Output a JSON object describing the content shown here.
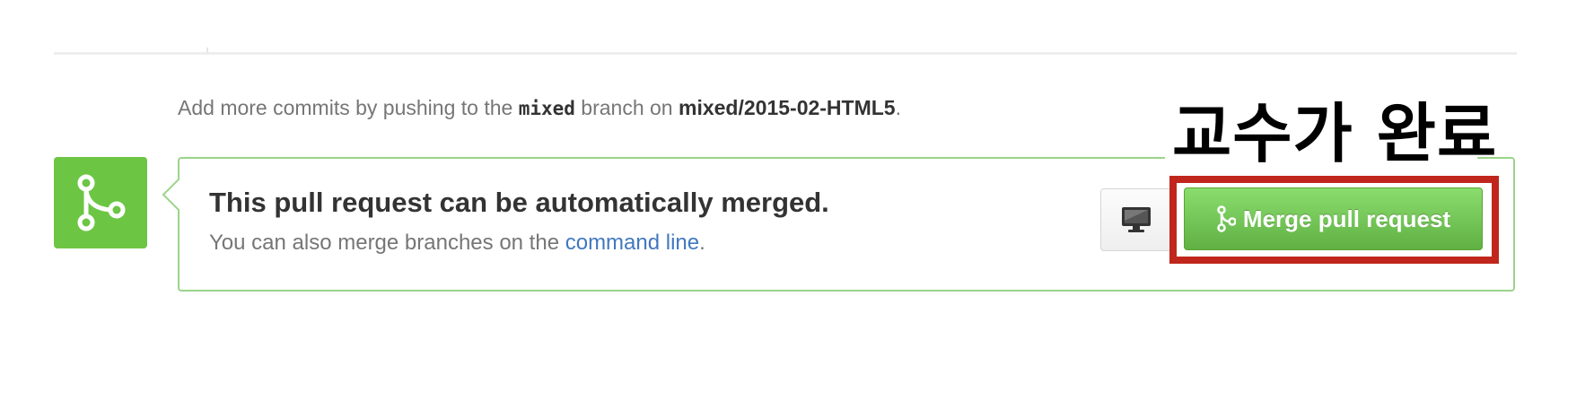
{
  "info": {
    "prefix": "Add more commits by pushing to the ",
    "branch": "mixed",
    "middle": " branch on ",
    "repo": "mixed/2015-02-HTML5",
    "suffix": "."
  },
  "merge_panel": {
    "title": "This pull request can be automatically merged.",
    "sub_prefix": "You can also merge branches on the ",
    "sub_link": "command line",
    "sub_suffix": "."
  },
  "buttons": {
    "desktop_icon": "desktop-icon",
    "merge_label": "Merge pull request",
    "merge_icon": "git-merge-icon"
  },
  "annotation": {
    "text": "교수가 완료"
  },
  "colors": {
    "success_green": "#6cc644",
    "panel_border": "#9bd48a",
    "link_blue": "#4078c0",
    "highlight_red": "#c0261c"
  }
}
